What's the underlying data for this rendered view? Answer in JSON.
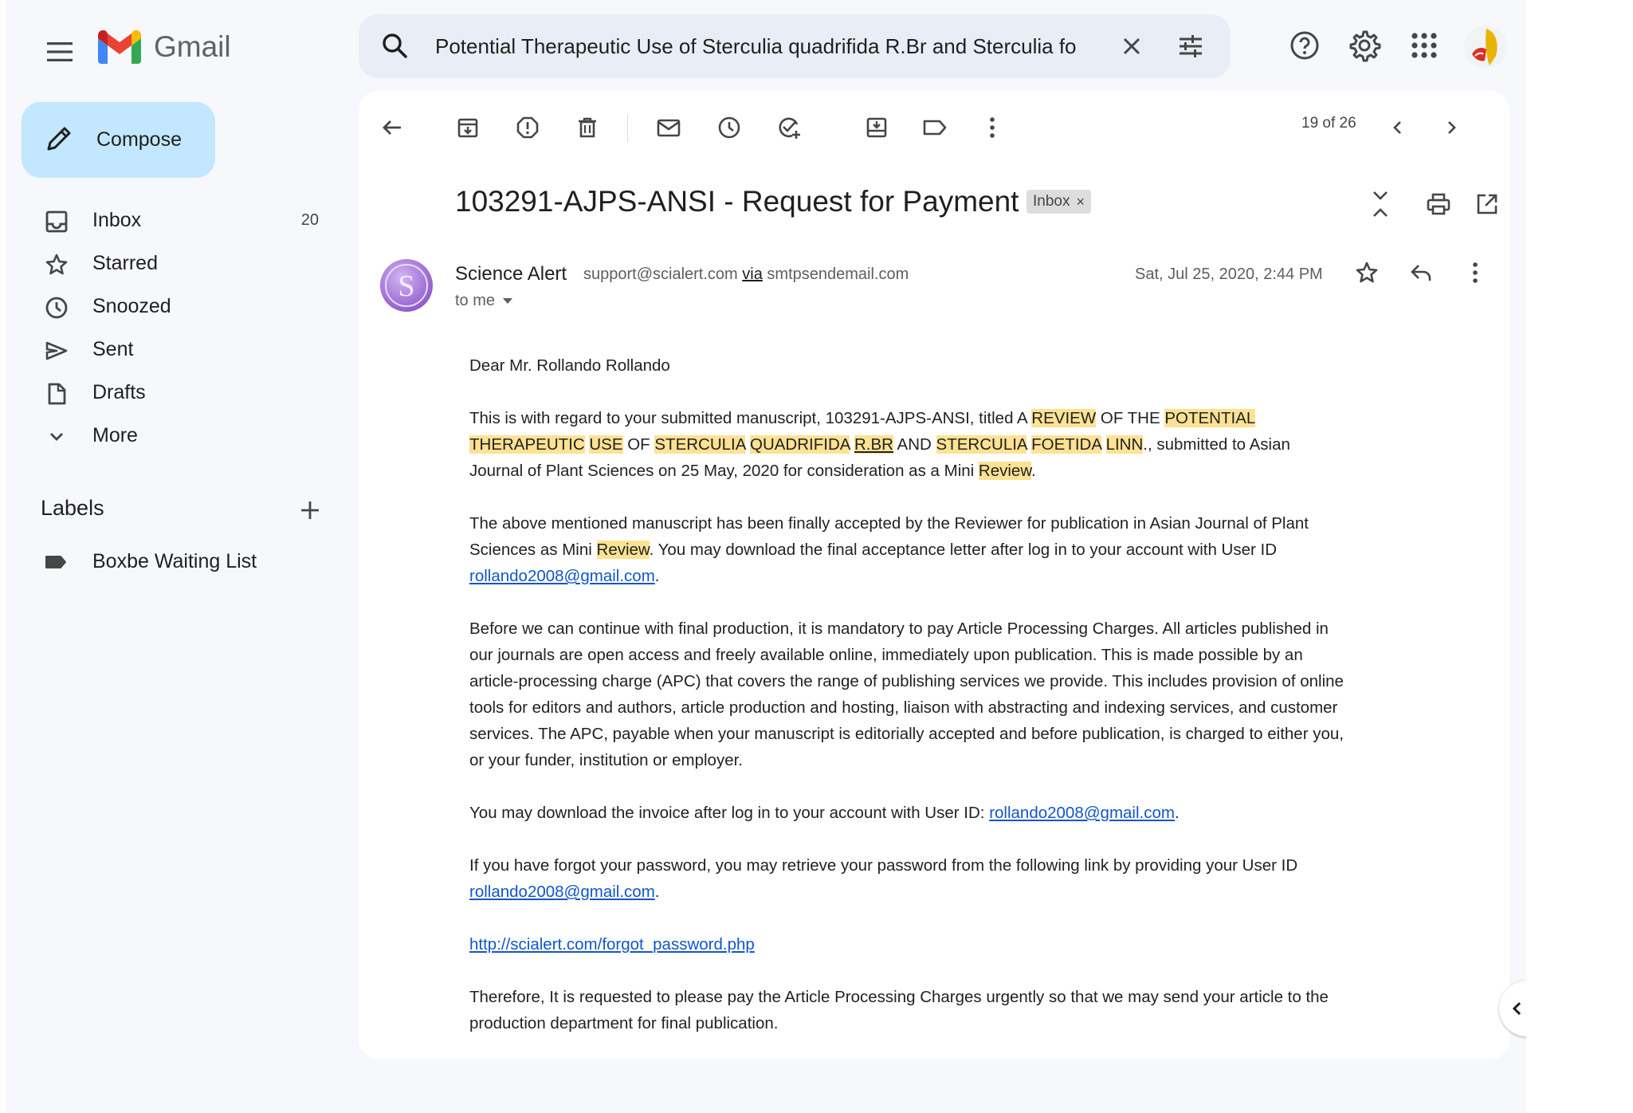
{
  "app": {
    "name": "Gmail"
  },
  "search": {
    "query": "Potential Therapeutic Use of Sterculia quadrifida R.Br and Sterculia fo"
  },
  "sidebar": {
    "compose_label": "Compose",
    "items": [
      {
        "label": "Inbox",
        "count": "20",
        "icon": "inbox-icon"
      },
      {
        "label": "Starred",
        "count": "",
        "icon": "star-icon"
      },
      {
        "label": "Snoozed",
        "count": "",
        "icon": "clock-icon"
      },
      {
        "label": "Sent",
        "count": "",
        "icon": "send-icon"
      },
      {
        "label": "Drafts",
        "count": "",
        "icon": "draft-icon"
      },
      {
        "label": "More",
        "count": "",
        "icon": "chevron-down-icon"
      }
    ],
    "labels_heading": "Labels",
    "labels": [
      {
        "label": "Boxbe Waiting List"
      }
    ]
  },
  "toolbar": {
    "pager": "19 of 26"
  },
  "message": {
    "subject": "103291-AJPS-ANSI - Request for Payment",
    "badge": "Inbox",
    "badge_close": "×",
    "avatar_letter": "S",
    "sender_name": "Science Alert",
    "sender_email": "support@scialert.com",
    "via": "via",
    "via_domain": "smtpsendemail.com",
    "recipient": "to me",
    "date": "Sat, Jul 25, 2020, 2:44 PM"
  },
  "body": {
    "greeting": "Dear Mr. Rollando Rollando",
    "p1": {
      "t1": "This is with regard to your submitted manuscript, 103291-AJPS-ANSI, titled A ",
      "h1": "REVIEW",
      "t2": " OF THE ",
      "h2": "POTENTIAL",
      "t3": " ",
      "h3": "THERAPEUTIC",
      "t4": " ",
      "h4": "USE",
      "t5": " OF ",
      "h5": "STERCULIA",
      "t6": " ",
      "h6": "QUADRIFIDA",
      "t7": " ",
      "h7": "R.BR",
      "t8": " AND ",
      "h8": "STERCULIA",
      "t9": " ",
      "h9": "FOETIDA",
      "t10": " ",
      "h10": "LINN",
      "t11": "., submitted to Asian Journal of Plant Sciences on 25 May, 2020 for consideration as a Mini ",
      "h11": "Review",
      "t12": "."
    },
    "p2": {
      "t1": "The above mentioned manuscript has been finally accepted by the Reviewer for publication in Asian Journal of Plant Sciences as Mini ",
      "h1": "Review",
      "t2": ". You may download the final acceptance letter after log in to your account with User ID ",
      "link": "rollando2008@gmail.com",
      "t3": "."
    },
    "p3": "Before we can continue with final production, it is mandatory to pay Article Processing Charges.  All articles published in our journals are open access and freely available online, immediately upon publication. This is made possible by an article-processing charge (APC) that covers the range of publishing services we provide. This includes provision of online tools for editors and authors, article production and hosting, liaison with abstracting and indexing services, and customer services. The APC, payable when your manuscript is editorially accepted and before publication, is charged to either you, or your funder, institution or employer.",
    "p4": {
      "t1": "You may download the invoice after log in to your account with User ID: ",
      "link": "rollando2008@gmail.com",
      "t2": "."
    },
    "p5": {
      "t1": "If you have forgot your password, you may retrieve your password from the following link by providing your User ID ",
      "link": "rollando2008@gmail.com",
      "t2": "."
    },
    "p6_link": "http://scialert.com/forgot_password.php",
    "p7": "Therefore, It is requested to please pay the Article Processing Charges urgently so that we may send your article to the production department for final publication."
  },
  "colors": {
    "background": "#f6f8fc",
    "search_bg": "#e9eef6",
    "compose_bg": "#c2e7ff",
    "highlight": "#fde293",
    "link": "#1155cc",
    "sender_avatar": "#a06bd6"
  }
}
